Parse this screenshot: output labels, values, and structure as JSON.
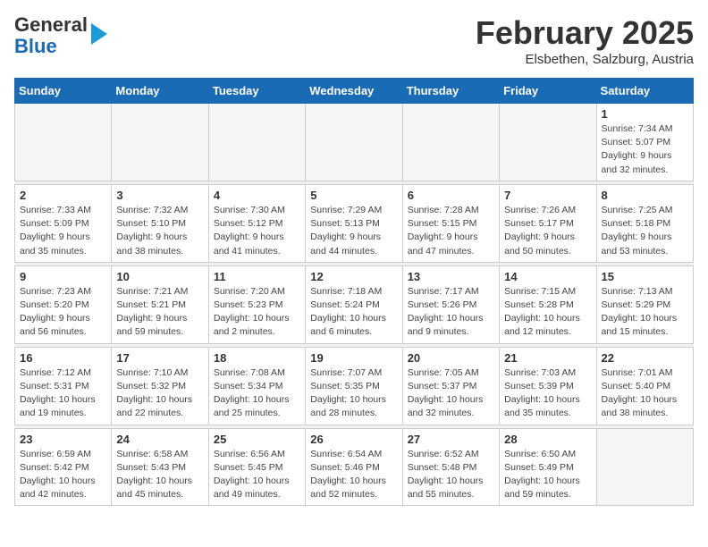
{
  "logo": {
    "general": "General",
    "blue": "Blue"
  },
  "title": "February 2025",
  "subtitle": "Elsbethen, Salzburg, Austria",
  "days_of_week": [
    "Sunday",
    "Monday",
    "Tuesday",
    "Wednesday",
    "Thursday",
    "Friday",
    "Saturday"
  ],
  "weeks": [
    [
      {
        "day": "",
        "info": ""
      },
      {
        "day": "",
        "info": ""
      },
      {
        "day": "",
        "info": ""
      },
      {
        "day": "",
        "info": ""
      },
      {
        "day": "",
        "info": ""
      },
      {
        "day": "",
        "info": ""
      },
      {
        "day": "1",
        "info": "Sunrise: 7:34 AM\nSunset: 5:07 PM\nDaylight: 9 hours and 32 minutes."
      }
    ],
    [
      {
        "day": "2",
        "info": "Sunrise: 7:33 AM\nSunset: 5:09 PM\nDaylight: 9 hours and 35 minutes."
      },
      {
        "day": "3",
        "info": "Sunrise: 7:32 AM\nSunset: 5:10 PM\nDaylight: 9 hours and 38 minutes."
      },
      {
        "day": "4",
        "info": "Sunrise: 7:30 AM\nSunset: 5:12 PM\nDaylight: 9 hours and 41 minutes."
      },
      {
        "day": "5",
        "info": "Sunrise: 7:29 AM\nSunset: 5:13 PM\nDaylight: 9 hours and 44 minutes."
      },
      {
        "day": "6",
        "info": "Sunrise: 7:28 AM\nSunset: 5:15 PM\nDaylight: 9 hours and 47 minutes."
      },
      {
        "day": "7",
        "info": "Sunrise: 7:26 AM\nSunset: 5:17 PM\nDaylight: 9 hours and 50 minutes."
      },
      {
        "day": "8",
        "info": "Sunrise: 7:25 AM\nSunset: 5:18 PM\nDaylight: 9 hours and 53 minutes."
      }
    ],
    [
      {
        "day": "9",
        "info": "Sunrise: 7:23 AM\nSunset: 5:20 PM\nDaylight: 9 hours and 56 minutes."
      },
      {
        "day": "10",
        "info": "Sunrise: 7:21 AM\nSunset: 5:21 PM\nDaylight: 9 hours and 59 minutes."
      },
      {
        "day": "11",
        "info": "Sunrise: 7:20 AM\nSunset: 5:23 PM\nDaylight: 10 hours and 2 minutes."
      },
      {
        "day": "12",
        "info": "Sunrise: 7:18 AM\nSunset: 5:24 PM\nDaylight: 10 hours and 6 minutes."
      },
      {
        "day": "13",
        "info": "Sunrise: 7:17 AM\nSunset: 5:26 PM\nDaylight: 10 hours and 9 minutes."
      },
      {
        "day": "14",
        "info": "Sunrise: 7:15 AM\nSunset: 5:28 PM\nDaylight: 10 hours and 12 minutes."
      },
      {
        "day": "15",
        "info": "Sunrise: 7:13 AM\nSunset: 5:29 PM\nDaylight: 10 hours and 15 minutes."
      }
    ],
    [
      {
        "day": "16",
        "info": "Sunrise: 7:12 AM\nSunset: 5:31 PM\nDaylight: 10 hours and 19 minutes."
      },
      {
        "day": "17",
        "info": "Sunrise: 7:10 AM\nSunset: 5:32 PM\nDaylight: 10 hours and 22 minutes."
      },
      {
        "day": "18",
        "info": "Sunrise: 7:08 AM\nSunset: 5:34 PM\nDaylight: 10 hours and 25 minutes."
      },
      {
        "day": "19",
        "info": "Sunrise: 7:07 AM\nSunset: 5:35 PM\nDaylight: 10 hours and 28 minutes."
      },
      {
        "day": "20",
        "info": "Sunrise: 7:05 AM\nSunset: 5:37 PM\nDaylight: 10 hours and 32 minutes."
      },
      {
        "day": "21",
        "info": "Sunrise: 7:03 AM\nSunset: 5:39 PM\nDaylight: 10 hours and 35 minutes."
      },
      {
        "day": "22",
        "info": "Sunrise: 7:01 AM\nSunset: 5:40 PM\nDaylight: 10 hours and 38 minutes."
      }
    ],
    [
      {
        "day": "23",
        "info": "Sunrise: 6:59 AM\nSunset: 5:42 PM\nDaylight: 10 hours and 42 minutes."
      },
      {
        "day": "24",
        "info": "Sunrise: 6:58 AM\nSunset: 5:43 PM\nDaylight: 10 hours and 45 minutes."
      },
      {
        "day": "25",
        "info": "Sunrise: 6:56 AM\nSunset: 5:45 PM\nDaylight: 10 hours and 49 minutes."
      },
      {
        "day": "26",
        "info": "Sunrise: 6:54 AM\nSunset: 5:46 PM\nDaylight: 10 hours and 52 minutes."
      },
      {
        "day": "27",
        "info": "Sunrise: 6:52 AM\nSunset: 5:48 PM\nDaylight: 10 hours and 55 minutes."
      },
      {
        "day": "28",
        "info": "Sunrise: 6:50 AM\nSunset: 5:49 PM\nDaylight: 10 hours and 59 minutes."
      },
      {
        "day": "",
        "info": ""
      }
    ]
  ]
}
